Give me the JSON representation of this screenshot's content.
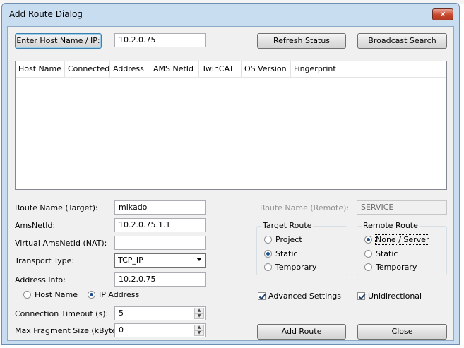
{
  "window": {
    "title": "Add Route Dialog",
    "close_label": "✕"
  },
  "toolbar": {
    "enter_host_label": "Enter Host Name / IP:",
    "host_value": "10.2.0.75",
    "refresh_label": "Refresh Status",
    "broadcast_label": "Broadcast Search"
  },
  "table": {
    "columns": [
      "Host Name",
      "Connected",
      "Address",
      "AMS NetId",
      "TwinCAT",
      "OS Version",
      "Fingerprint"
    ]
  },
  "form": {
    "route_name_label": "Route Name (Target):",
    "route_name_value": "mikado",
    "amsnetid_label": "AmsNetId:",
    "amsnetid_value": "10.2.0.75.1.1",
    "virtual_label": "Virtual AmsNetId (NAT):",
    "virtual_value": "",
    "transport_label": "Transport Type:",
    "transport_value": "TCP_IP",
    "address_label": "Address Info:",
    "address_value": "10.2.0.75",
    "host_name_radio": "Host Name",
    "ip_address_radio": "IP Address",
    "timeout_label": "Connection Timeout (s):",
    "timeout_value": "5",
    "fragment_label": "Max Fragment Size (kByte):",
    "fragment_value": "0"
  },
  "remote": {
    "route_name_remote_label": "Route Name (Remote):",
    "route_name_remote_value": "SERVICE"
  },
  "target_route": {
    "title": "Target Route",
    "options": [
      "Project",
      "Static",
      "Temporary"
    ],
    "selected": "Static"
  },
  "remote_route": {
    "title": "Remote Route",
    "options": [
      "None / Server",
      "Static",
      "Temporary"
    ],
    "selected": "None / Server"
  },
  "options": {
    "advanced_label": "Advanced Settings",
    "advanced_checked": true,
    "unidirectional_label": "Unidirectional",
    "unidirectional_checked": true
  },
  "actions": {
    "add_route_label": "Add Route",
    "close_label": "Close"
  }
}
